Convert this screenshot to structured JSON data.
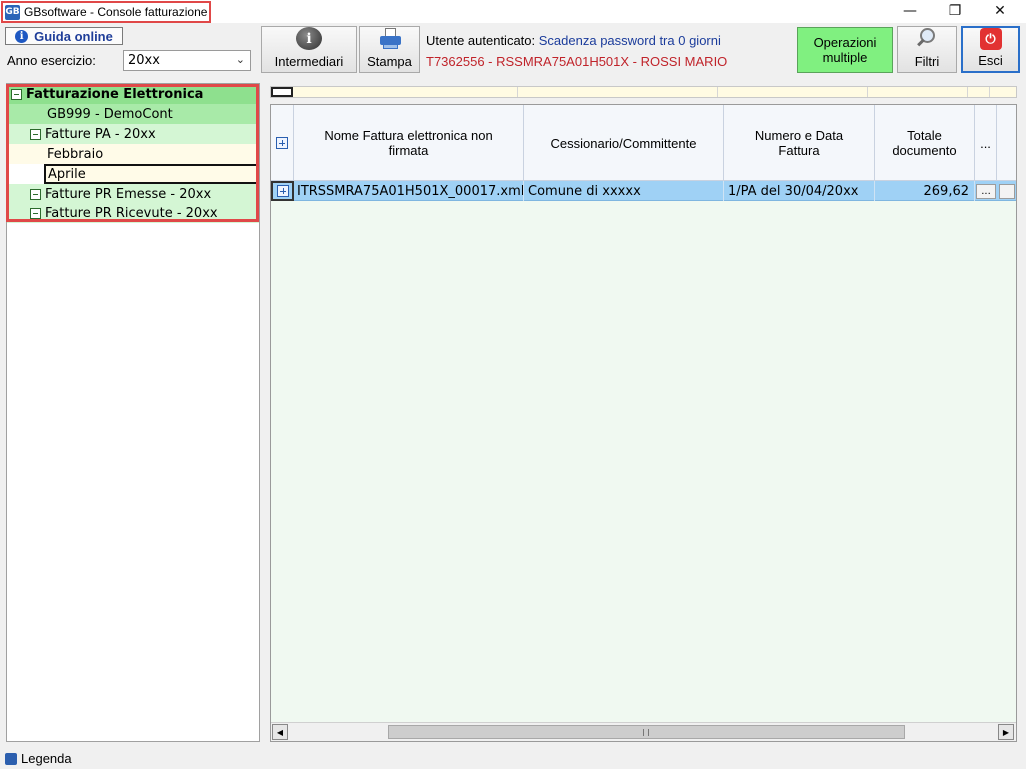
{
  "window": {
    "title": "GBsoftware - Console fatturazione",
    "logo": "GB",
    "controls": {
      "minimize": "—",
      "restore": "❐",
      "close": "✕"
    }
  },
  "toolbar": {
    "guida_label": "Guida online",
    "anno_label": "Anno esercizio:",
    "anno_value": "20xx",
    "intermediari_label": "Intermediari",
    "stampa_label": "Stampa",
    "operazioni_label_1": "Operazioni",
    "operazioni_label_2": "multiple",
    "filtri_label": "Filtri",
    "esci_label": "Esci"
  },
  "auth": {
    "label": "Utente autenticato:",
    "value": "Scadenza password tra 0 giorni",
    "user_line": "T7362556 - RSSMRA75A01H501X - ROSSI MARIO"
  },
  "tree": {
    "root": "Fatturazione Elettronica",
    "company": "GB999 - DemoCont",
    "fatture_pa": "Fatture PA - 20xx",
    "month_1": "Febbraio",
    "month_2": "Aprile",
    "pr_emesse": "Fatture PR Emesse - 20xx",
    "pr_ricevute": "Fatture PR Ricevute - 20xx"
  },
  "grid": {
    "columns": {
      "nome_1": "Nome Fattura elettronica non",
      "nome_2": "firmata",
      "cessionario": "Cessionario/Committente",
      "numero_1": "Numero e Data",
      "numero_2": "Fattura",
      "totale_1": "Totale",
      "totale_2": "documento",
      "more": "..."
    },
    "rows": [
      {
        "nome": "ITRSSMRA75A01H501X_00017.xml",
        "cessionario": "Comune di xxxxx",
        "numero": "1/PA del 30/04/20xx",
        "totale": "269,62",
        "more": "..."
      }
    ]
  },
  "status": {
    "legenda": "Legenda"
  },
  "colors": {
    "highlight_red": "#e04848",
    "tree_green": "#8ee08e",
    "tree_light_green": "#d4f6d4",
    "selected_row": "#9fd1f5",
    "operazioni_green": "#80f080",
    "user_red": "#c0232a",
    "auth_blue": "#1b3c9b"
  }
}
